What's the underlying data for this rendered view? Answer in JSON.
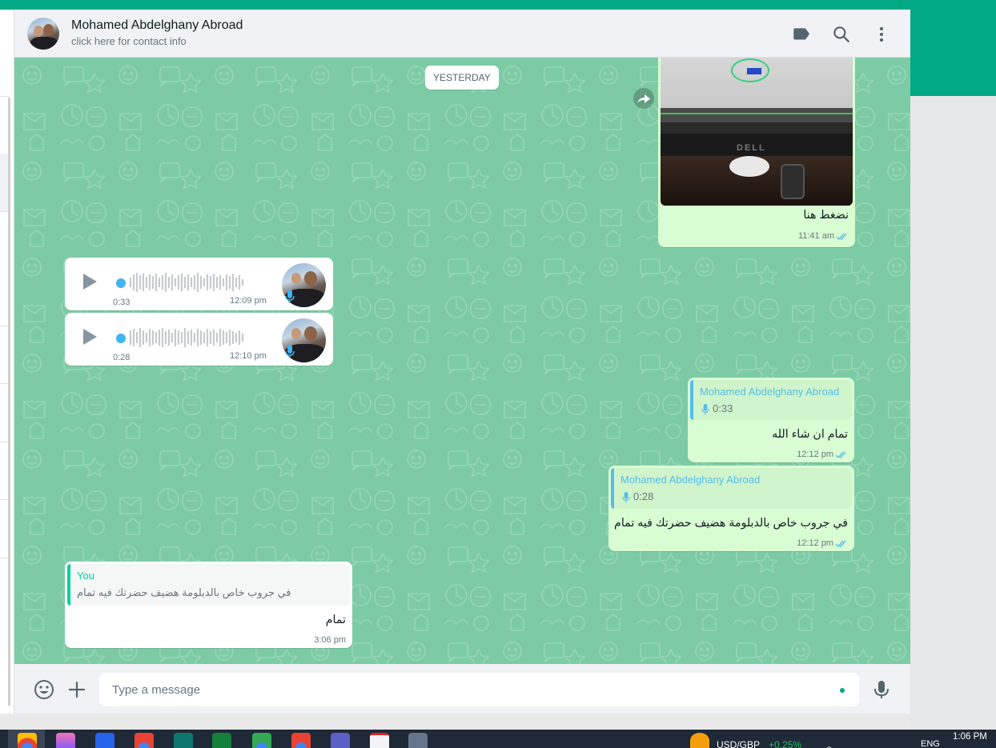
{
  "header": {
    "contact_name": "Mohamed Abdelghany Abroad",
    "contact_subtitle": "click here for contact info",
    "icons": [
      "label-icon",
      "search-icon",
      "menu-icon"
    ]
  },
  "chat": {
    "date_divider": "YESTERDAY",
    "image_message": {
      "caption": "نضغط هنا",
      "time": "11:41 am",
      "status": "read"
    },
    "voice_messages": [
      {
        "duration": "0:33",
        "time": "12:09 pm"
      },
      {
        "duration": "0:28",
        "time": "12:10 pm"
      }
    ],
    "reply_messages": [
      {
        "quoted_name": "Mohamed Abdelghany Abroad",
        "quoted_duration": "0:33",
        "text": "تمام ان شاء الله",
        "time": "12:12 pm",
        "status": "read"
      },
      {
        "quoted_name": "Mohamed Abdelghany Abroad",
        "quoted_duration": "0:28",
        "text": "في جروب خاص بالدبلومة هضيف حضرتك فيه تمام",
        "time": "12:12 pm",
        "status": "read"
      }
    ],
    "incoming_reply": {
      "quoted_name": "You",
      "quoted_text": "في جروب خاص بالدبلومة هضيف حضرتك فيه تمام",
      "text": "تمام",
      "time": "3:06 pm"
    }
  },
  "composer": {
    "placeholder": "Type a message"
  },
  "taskbar": {
    "currency_pair": "USD/GBP",
    "currency_change": "+0.25%",
    "language": "ENG",
    "clock": "1:06 PM"
  },
  "colors": {
    "accent": "#00a884",
    "chat_background": "#7dcba5",
    "outgoing_bubble": "#d9fdd3",
    "read_ticks": "#53bdeb",
    "quote_incoming": "#06cf9c",
    "quote_outgoing": "#53bdeb"
  }
}
